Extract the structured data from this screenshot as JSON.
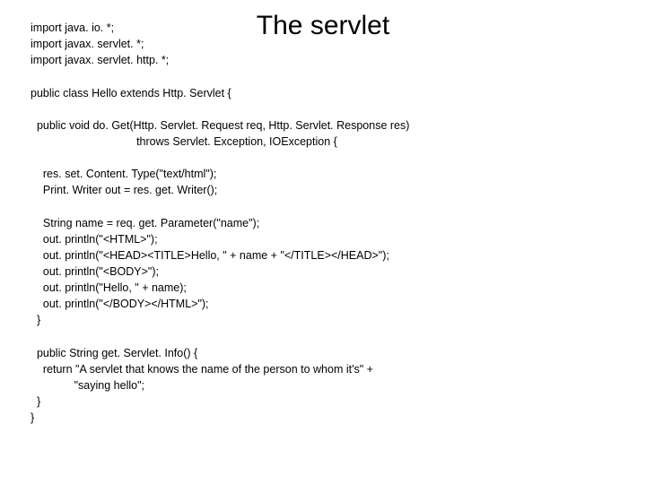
{
  "title": "The servlet",
  "code": {
    "imports": [
      "import java. io. *;",
      "import javax. servlet. *;",
      "import javax. servlet. http. *;"
    ],
    "class_decl": "public class Hello extends Http. Servlet {",
    "method1_sig1": "  public void do. Get(Http. Servlet. Request req, Http. Servlet. Response res)",
    "method1_sig2": "                                  throws Servlet. Exception, IOException {",
    "body1_l1": "    res. set. Content. Type(\"text/html\");",
    "body1_l2": "    Print. Writer out = res. get. Writer();",
    "body2_l1": "    String name = req. get. Parameter(\"name\");",
    "body2_l2": "    out. println(\"<HTML>\");",
    "body2_l3": "    out. println(\"<HEAD><TITLE>Hello, \" + name + \"</TITLE></HEAD>\");",
    "body2_l4": "    out. println(\"<BODY>\");",
    "body2_l5": "    out. println(\"Hello, \" + name);",
    "body2_l6": "    out. println(\"</BODY></HTML>\");",
    "body2_l7": "  }",
    "method2_l1": "  public String get. Servlet. Info() {",
    "method2_l2": "    return \"A servlet that knows the name of the person to whom it's\" +",
    "method2_l3": "              \"saying hello\";",
    "method2_l4": "  }",
    "method2_l5": "}"
  }
}
